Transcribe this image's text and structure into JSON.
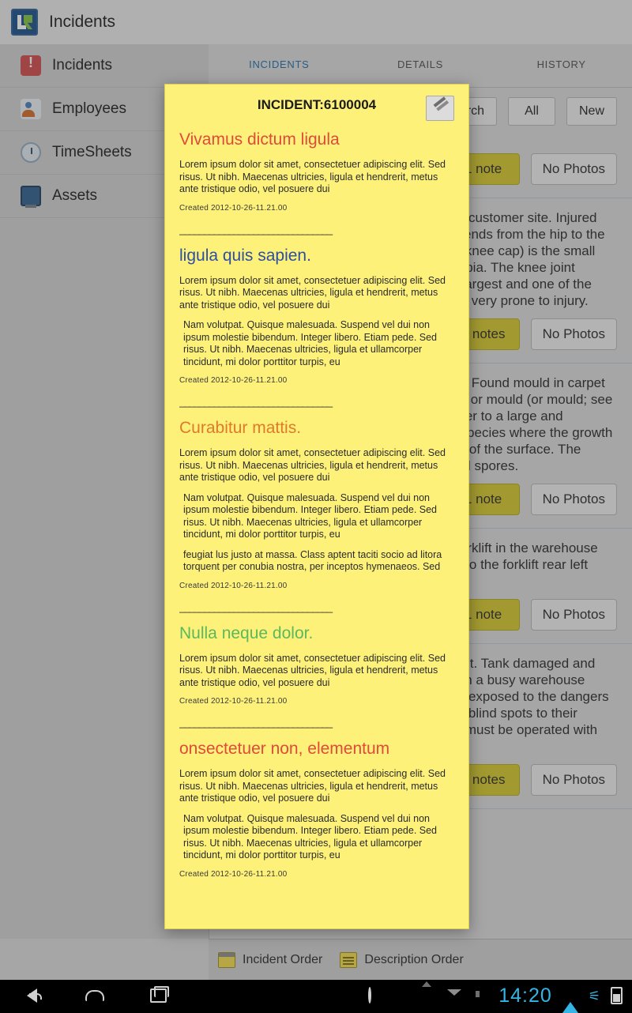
{
  "app": {
    "title": "Incidents",
    "logo_icon": "lr-logo-icon"
  },
  "sidebar": {
    "items": [
      {
        "label": "Incidents",
        "icon": "incident-icon"
      },
      {
        "label": "Employees",
        "icon": "employees-icon"
      },
      {
        "label": "TimeSheets",
        "icon": "timesheets-icon"
      },
      {
        "label": "Assets",
        "icon": "assets-icon"
      }
    ]
  },
  "tabs": [
    {
      "label": "INCIDENTS",
      "active": true
    },
    {
      "label": "DETAILS",
      "active": false
    },
    {
      "label": "HISTORY",
      "active": false
    }
  ],
  "toolbar": {
    "search_label": "Search",
    "all_label": "All",
    "new_label": "New"
  },
  "list": {
    "rows": [
      {
        "text": "",
        "notes_label": "1 note",
        "photos_label": "No Photos"
      },
      {
        "text": "Employee slipped and fell on wet floor at customer site. Injured both legs. The femur is the bone that extends from the hip to the thigh with the leg and knee. The patella (knee cap) is the small round bone between the femur and the tibia. The knee joint connects the femur and patella. It is the largest and one of the strongest joints in the human body and is very prone to injury.",
        "notes_label": "5 notes",
        "photos_label": "No Photos"
      },
      {
        "text": "Employee complained of a mouldy smell. Found mould in carpet under sink in the kitchen area. Mold (US) or mould (or mould; see spelling differences) is a term used to refer to a large and taxonomically diverse number of fungal species where the growth of hyphae results in a moldy appearance of the surface. The carpet was discolored by a layer of mould spores.",
        "notes_label": "1 note",
        "photos_label": "No Photos"
      },
      {
        "text": "Truck reversed into a parked company forklift in the warehouse yard. No injury to employee but damage to the forklift rear left taillight broken and bumper dented.",
        "notes_label": "1 note",
        "photos_label": "No Photos"
      },
      {
        "text": "Forklift collided with the water storage unit. Tank damaged and leaking. See photos for details. A forklift in a busy warehouse environment then all employees must be exposed to the dangers of forklift operations. Forklifts have many blind spots to their operators and to other employees. They must be operated with great care.",
        "notes_label": "9 notes",
        "photos_label": "No Photos"
      }
    ]
  },
  "bottombar": {
    "incident_order_label": "Incident Order",
    "description_order_label": "Description Order"
  },
  "note_dialog": {
    "header_title": "INCIDENT:6100004",
    "edit_icon": "edit-note-icon",
    "separator": "_______________________________",
    "notes": [
      {
        "title": "Vivamus dictum ligula",
        "title_color": "#e04a3a",
        "paragraphs": [
          "Lorem ipsum dolor sit amet, consectetuer adipiscing elit. Sed risus. Ut nibh. Maecenas ultricies, ligula et  hendrerit, metus ante tristique odio, vel posuere dui"
        ],
        "created": "Created 2012-10-26-11.21.00"
      },
      {
        "title": "ligula quis sapien.",
        "title_color": "#2c4fa3",
        "paragraphs": [
          "Lorem ipsum dolor sit amet, consectetuer adipiscing elit. Sed risus. Ut nibh. Maecenas ultricies, ligula et  hendrerit, metus ante tristique odio, vel posuere dui",
          "Nam volutpat. Quisque malesuada. Suspend vel dui non  ipsum molestie bibendum. Integer libero. Etiam pede.  Sed risus. Ut nibh. Maecenas ultricies, ligula et ullamcorper tincidunt, mi dolor porttitor turpis, eu"
        ],
        "created": "Created 2012-10-26-11.21.00"
      },
      {
        "title": "Curabitur mattis.",
        "title_color": "#e07a2a",
        "paragraphs": [
          "Lorem ipsum dolor sit amet, consectetuer adipiscing elit. Sed risus. Ut nibh. Maecenas ultricies, ligula et  hendrerit, metus ante tristique odio, vel posuere dui",
          "Nam volutpat. Quisque malesuada. Suspend vel dui non  ipsum molestie bibendum. Integer libero. Etiam pede.  Sed risus. Ut nibh. Maecenas ultricies, ligula et ullamcorper tincidunt, mi dolor porttitor turpis, eu",
          "feugiat lus justo at massa. Class aptent taciti socio ad litora torquent per conubia nostra, per inceptos hymenaeos. Sed"
        ],
        "created": "Created 2012-10-26-11.21.00"
      },
      {
        "title": "Nulla neque dolor.",
        "title_color": "#5cb85c",
        "paragraphs": [
          "Lorem ipsum dolor sit amet, consectetuer adipiscing elit. Sed risus. Ut nibh. Maecenas ultricies, ligula et  hendrerit, metus ante tristique odio, vel posuere dui"
        ],
        "created": "Created 2012-10-26-11.21.00"
      },
      {
        "title": "onsectetuer non, elementum",
        "title_color": "#e04a3a",
        "paragraphs": [
          "Lorem ipsum dolor sit amet, consectetuer adipiscing elit. Sed risus. Ut nibh. Maecenas ultricies, ligula et  hendrerit, metus ante tristique odio, vel posuere dui",
          "Nam volutpat. Quisque malesuada. Suspend vel dui non  ipsum molestie bibendum. Integer libero. Etiam pede.  Sed risus. Ut nibh. Maecenas ultricies, ligula et ullamcorper tincidunt, mi dolor porttitor turpis, eu"
        ],
        "created": "Created 2012-10-26-11.21.00"
      }
    ]
  },
  "system_bar": {
    "back_icon": "back-icon",
    "home_icon": "home-icon",
    "recents_icon": "recents-icon",
    "clock": "14:20",
    "tray_icons": [
      "ring-icon",
      "sd-card-icon",
      "image-icon",
      "mail-icon",
      "usb-icon",
      "wifi-icon",
      "bluetooth-icon",
      "battery-icon"
    ]
  },
  "colors": {
    "accent": "#3391d4",
    "note_bg": "#fdf17a",
    "badge": "#d3c72b"
  }
}
